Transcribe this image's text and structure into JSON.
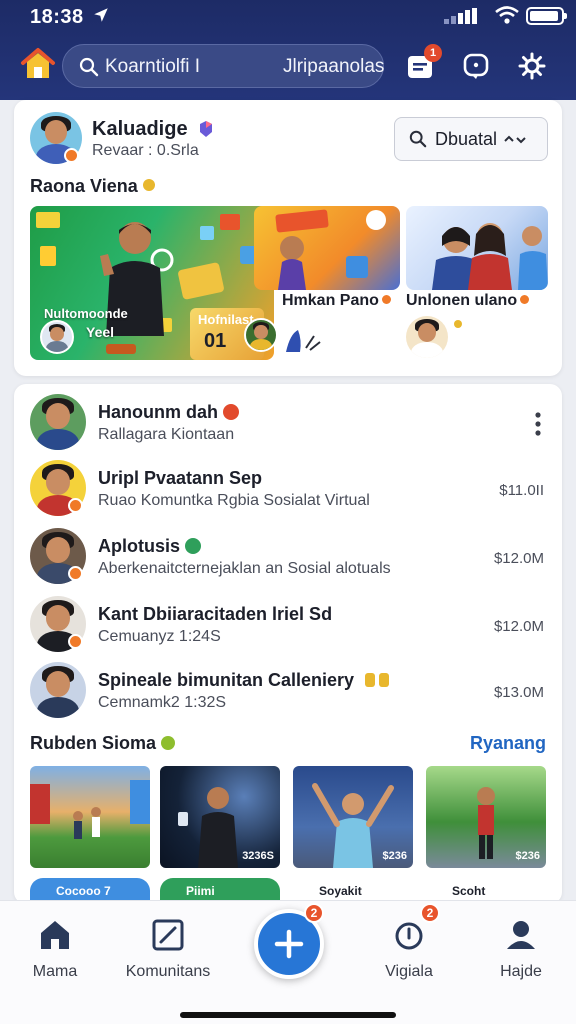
{
  "status_bar": {
    "time": "18:38",
    "icons": [
      "location-arrow-icon",
      "signal-icon",
      "wifi-icon",
      "battery-icon"
    ]
  },
  "header": {
    "logo": "home-logo-icon",
    "search": {
      "placeholder_left": "Koarntiolfi I",
      "placeholder_right": "Jlripaanolas"
    },
    "notifications_badge": "1",
    "icons": [
      "notifications-icon",
      "chat-icon",
      "settings-icon"
    ]
  },
  "profile": {
    "name": "Kaluadige",
    "subtitle": "Revaar : 0.Srla",
    "dropdown_label": "Dbuatal"
  },
  "stories": {
    "title": "Raona Viena",
    "big_tile": {
      "caption_top": "Nultomoonde",
      "caption_bottom": "Yeel"
    },
    "promo_card": {
      "top": "Hofnilast",
      "bottom": "01"
    },
    "items": [
      {
        "label": "Hmkan Pano"
      },
      {
        "label": "Unlonen ulano"
      }
    ]
  },
  "list": {
    "items": [
      {
        "name": "Hanounm dah",
        "subtitle": "Rallagara Kiontaan",
        "amount": ""
      },
      {
        "name": "Uripl Pvaatann Sep",
        "subtitle": "Ruao Komuntka Rgbia Sosialat Virtual",
        "amount": "$11.0II"
      },
      {
        "name": "Aplotusis",
        "subtitle": "Aberkenaitcternejaklan an Sosial alotuals",
        "amount": "$12.0M"
      },
      {
        "name": "Kant Dbiiaracitaden lriel Sd",
        "subtitle": "Cemuanyz 1:24S",
        "amount": "$12.0M"
      },
      {
        "name": "Spineale bimunitan Calleniery",
        "subtitle": "Cemnamk2 1:32S",
        "amount": "$13.0M"
      }
    ]
  },
  "recommended": {
    "title": "Rubden Sioma",
    "see_all": "Ryanang",
    "thumbs": [
      {
        "tag": ""
      },
      {
        "tag": "3236S"
      },
      {
        "tag": "$236"
      },
      {
        "tag": "$236"
      }
    ],
    "chips": [
      "Cocooo 7",
      "Piimi",
      "Soyakit",
      "Scoht"
    ]
  },
  "bottom_nav": {
    "items": [
      {
        "label": "Mama",
        "icon": "home-icon"
      },
      {
        "label": "Komunitans",
        "icon": "edit-icon"
      },
      {
        "label": "",
        "icon": "plus-icon",
        "badge": "2"
      },
      {
        "label": "Vigiala",
        "icon": "power-icon",
        "badge": "2"
      },
      {
        "label": "Hajde",
        "icon": "profile-icon"
      }
    ]
  },
  "colors": {
    "header_bg": "#1d2b66",
    "accent_blue": "#2776d6",
    "badge_orange": "#e8542c",
    "link_blue": "#2166c2"
  }
}
